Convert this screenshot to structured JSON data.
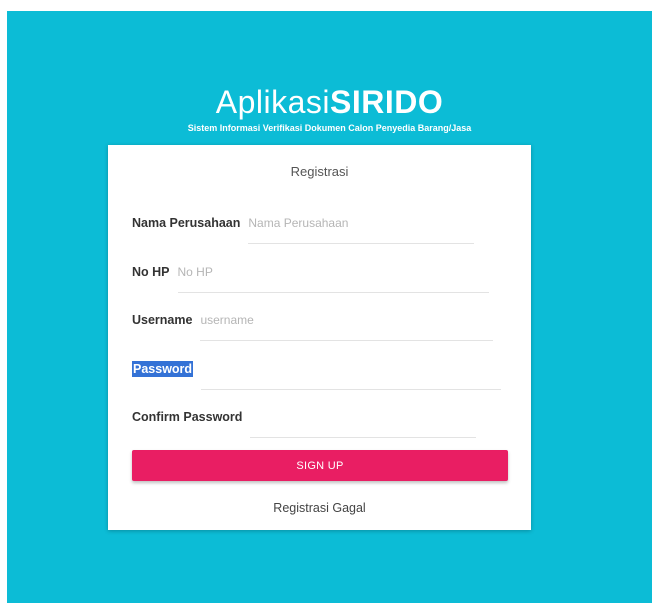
{
  "app": {
    "title_light": "Aplikasi",
    "title_bold": "SIRIDO",
    "subtitle": "Sistem Informasi Verifikasi Dokumen Calon Penyedia Barang/Jasa"
  },
  "form": {
    "title": "Registrasi",
    "fields": [
      {
        "label": "Nama Perusahaan",
        "placeholder": "Nama Perusahaan",
        "value": ""
      },
      {
        "label": "No HP",
        "placeholder": "No HP",
        "value": ""
      },
      {
        "label": "Username",
        "placeholder": "username",
        "value": ""
      },
      {
        "label": "Password",
        "placeholder": "",
        "value": "",
        "label_selected": true
      },
      {
        "label": "Confirm Password",
        "placeholder": "",
        "value": ""
      }
    ],
    "submit_label": "SIGN UP",
    "status_message": "Registrasi Gagal"
  },
  "colors": {
    "background": "#0cbcd6",
    "card": "#ffffff",
    "button": "#e91e63",
    "selection": "#3472d6"
  }
}
